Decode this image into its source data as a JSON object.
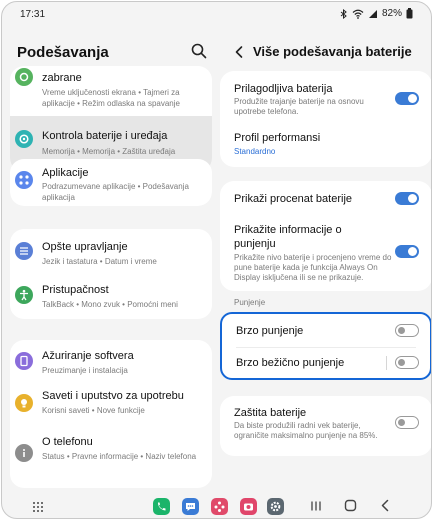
{
  "status_bar": {
    "time": "17:31",
    "battery": "82%"
  },
  "left_pane": {
    "title": "Podešavanja",
    "items": [
      {
        "title": "zabrane",
        "subtitle": "Vreme uključenosti ekrana • Tajmeri za aplikacije • Režim odlaska na spavanje",
        "icon": "digital-wellbeing-icon",
        "color": "#56b35f"
      },
      {
        "title": "Kontrola baterije i uređaja",
        "subtitle": "Memorija • Memorija • Zaštita uređaja",
        "icon": "device-care-icon",
        "color": "#2eb3b3"
      },
      {
        "title": "Aplikacije",
        "subtitle": "Podrazumevane aplikacije • Podešavanja aplikacija",
        "icon": "apps-icon",
        "color": "#5a86ec"
      },
      {
        "title": "Opšte upravljanje",
        "subtitle": "Jezik i tastatura • Datum i vreme",
        "icon": "general-management-icon",
        "color": "#5a7fd6"
      },
      {
        "title": "Pristupačnost",
        "subtitle": "TalkBack • Mono zvuk • Pomoćni meni",
        "icon": "accessibility-icon",
        "color": "#3da75c"
      },
      {
        "title": "Ažuriranje softvera",
        "subtitle": "Preuzimanje i instalacija",
        "icon": "software-update-icon",
        "color": "#8a6ddb"
      },
      {
        "title": "Saveti i uputstvo za upotrebu",
        "subtitle": "Korisni saveti • Nove funkcije",
        "icon": "tips-icon",
        "color": "#e8b12c"
      },
      {
        "title": "O telefonu",
        "subtitle": "Status • Pravne informacije • Naziv telefona",
        "icon": "about-phone-icon",
        "color": "#8d8d8d"
      }
    ]
  },
  "right_pane": {
    "title": "Više podešavanja baterije",
    "adaptive_battery": {
      "title": "Prilagodljiva baterija",
      "subtitle": "Produžite trajanje baterije na osnovu upotrebe telefona.",
      "on": true
    },
    "performance_profile": {
      "title": "Profil performansi",
      "value": "Standardno"
    },
    "show_percentage": {
      "title": "Prikaži procenat baterije",
      "on": true
    },
    "charging_info": {
      "title": "Prikažite informacije o punjenju",
      "subtitle": "Prikažite nivo baterije i procenjeno vreme do pune baterije kada je funkcija Always On Display isključena ili se ne prikazuje.",
      "on": true
    },
    "section_charging": "Punjenje",
    "fast_charging": {
      "title": "Brzo punjenje",
      "on": false
    },
    "fast_wireless_charging": {
      "title": "Brzo bežično punjenje",
      "on": false
    },
    "protect_battery": {
      "title": "Zaštita baterije",
      "subtitle": "Da biste produžili radni vek baterije, ograničite maksimalno punjenje na 85%.",
      "on": false
    }
  },
  "nav_bar": {
    "apps": [
      {
        "icon": "phone-app-icon",
        "color": "#1bb46a"
      },
      {
        "icon": "messages-app-icon",
        "color": "#3a7bd5"
      },
      {
        "icon": "bixby-app-icon",
        "color": "#e04a6a"
      },
      {
        "icon": "camera-app-icon",
        "color": "#e0456a"
      },
      {
        "icon": "settings-app-icon",
        "color": "#5b6770"
      }
    ]
  }
}
